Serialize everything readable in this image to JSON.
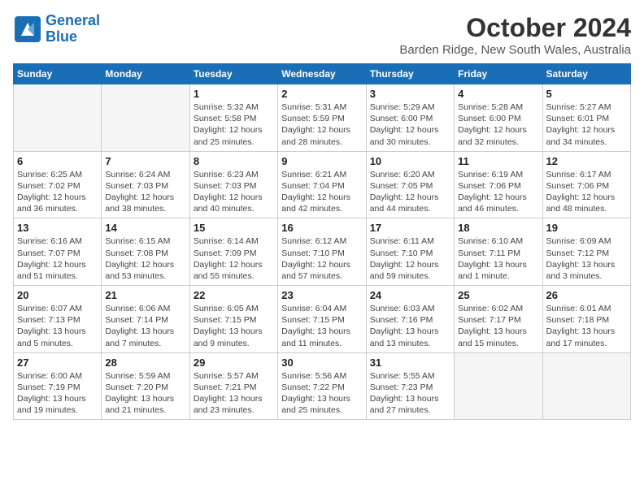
{
  "header": {
    "logo_line1": "General",
    "logo_line2": "Blue",
    "month": "October 2024",
    "location": "Barden Ridge, New South Wales, Australia"
  },
  "weekdays": [
    "Sunday",
    "Monday",
    "Tuesday",
    "Wednesday",
    "Thursday",
    "Friday",
    "Saturday"
  ],
  "weeks": [
    [
      {
        "day": "",
        "info": ""
      },
      {
        "day": "",
        "info": ""
      },
      {
        "day": "1",
        "info": "Sunrise: 5:32 AM\nSunset: 5:58 PM\nDaylight: 12 hours\nand 25 minutes."
      },
      {
        "day": "2",
        "info": "Sunrise: 5:31 AM\nSunset: 5:59 PM\nDaylight: 12 hours\nand 28 minutes."
      },
      {
        "day": "3",
        "info": "Sunrise: 5:29 AM\nSunset: 6:00 PM\nDaylight: 12 hours\nand 30 minutes."
      },
      {
        "day": "4",
        "info": "Sunrise: 5:28 AM\nSunset: 6:00 PM\nDaylight: 12 hours\nand 32 minutes."
      },
      {
        "day": "5",
        "info": "Sunrise: 5:27 AM\nSunset: 6:01 PM\nDaylight: 12 hours\nand 34 minutes."
      }
    ],
    [
      {
        "day": "6",
        "info": "Sunrise: 6:25 AM\nSunset: 7:02 PM\nDaylight: 12 hours\nand 36 minutes."
      },
      {
        "day": "7",
        "info": "Sunrise: 6:24 AM\nSunset: 7:03 PM\nDaylight: 12 hours\nand 38 minutes."
      },
      {
        "day": "8",
        "info": "Sunrise: 6:23 AM\nSunset: 7:03 PM\nDaylight: 12 hours\nand 40 minutes."
      },
      {
        "day": "9",
        "info": "Sunrise: 6:21 AM\nSunset: 7:04 PM\nDaylight: 12 hours\nand 42 minutes."
      },
      {
        "day": "10",
        "info": "Sunrise: 6:20 AM\nSunset: 7:05 PM\nDaylight: 12 hours\nand 44 minutes."
      },
      {
        "day": "11",
        "info": "Sunrise: 6:19 AM\nSunset: 7:06 PM\nDaylight: 12 hours\nand 46 minutes."
      },
      {
        "day": "12",
        "info": "Sunrise: 6:17 AM\nSunset: 7:06 PM\nDaylight: 12 hours\nand 48 minutes."
      }
    ],
    [
      {
        "day": "13",
        "info": "Sunrise: 6:16 AM\nSunset: 7:07 PM\nDaylight: 12 hours\nand 51 minutes."
      },
      {
        "day": "14",
        "info": "Sunrise: 6:15 AM\nSunset: 7:08 PM\nDaylight: 12 hours\nand 53 minutes."
      },
      {
        "day": "15",
        "info": "Sunrise: 6:14 AM\nSunset: 7:09 PM\nDaylight: 12 hours\nand 55 minutes."
      },
      {
        "day": "16",
        "info": "Sunrise: 6:12 AM\nSunset: 7:10 PM\nDaylight: 12 hours\nand 57 minutes."
      },
      {
        "day": "17",
        "info": "Sunrise: 6:11 AM\nSunset: 7:10 PM\nDaylight: 12 hours\nand 59 minutes."
      },
      {
        "day": "18",
        "info": "Sunrise: 6:10 AM\nSunset: 7:11 PM\nDaylight: 13 hours\nand 1 minute."
      },
      {
        "day": "19",
        "info": "Sunrise: 6:09 AM\nSunset: 7:12 PM\nDaylight: 13 hours\nand 3 minutes."
      }
    ],
    [
      {
        "day": "20",
        "info": "Sunrise: 6:07 AM\nSunset: 7:13 PM\nDaylight: 13 hours\nand 5 minutes."
      },
      {
        "day": "21",
        "info": "Sunrise: 6:06 AM\nSunset: 7:14 PM\nDaylight: 13 hours\nand 7 minutes."
      },
      {
        "day": "22",
        "info": "Sunrise: 6:05 AM\nSunset: 7:15 PM\nDaylight: 13 hours\nand 9 minutes."
      },
      {
        "day": "23",
        "info": "Sunrise: 6:04 AM\nSunset: 7:15 PM\nDaylight: 13 hours\nand 11 minutes."
      },
      {
        "day": "24",
        "info": "Sunrise: 6:03 AM\nSunset: 7:16 PM\nDaylight: 13 hours\nand 13 minutes."
      },
      {
        "day": "25",
        "info": "Sunrise: 6:02 AM\nSunset: 7:17 PM\nDaylight: 13 hours\nand 15 minutes."
      },
      {
        "day": "26",
        "info": "Sunrise: 6:01 AM\nSunset: 7:18 PM\nDaylight: 13 hours\nand 17 minutes."
      }
    ],
    [
      {
        "day": "27",
        "info": "Sunrise: 6:00 AM\nSunset: 7:19 PM\nDaylight: 13 hours\nand 19 minutes."
      },
      {
        "day": "28",
        "info": "Sunrise: 5:59 AM\nSunset: 7:20 PM\nDaylight: 13 hours\nand 21 minutes."
      },
      {
        "day": "29",
        "info": "Sunrise: 5:57 AM\nSunset: 7:21 PM\nDaylight: 13 hours\nand 23 minutes."
      },
      {
        "day": "30",
        "info": "Sunrise: 5:56 AM\nSunset: 7:22 PM\nDaylight: 13 hours\nand 25 minutes."
      },
      {
        "day": "31",
        "info": "Sunrise: 5:55 AM\nSunset: 7:23 PM\nDaylight: 13 hours\nand 27 minutes."
      },
      {
        "day": "",
        "info": ""
      },
      {
        "day": "",
        "info": ""
      }
    ]
  ]
}
